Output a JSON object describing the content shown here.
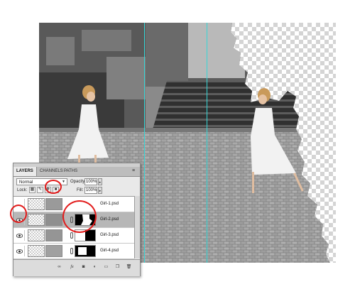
{
  "layers_panel": {
    "tabs": [
      "LAYERS",
      "CHANNELS",
      "PATHS"
    ],
    "blend_mode": "Normal",
    "opacity_label": "Opacity:",
    "opacity_value": "100%",
    "lock_label": "Lock:",
    "fill_label": "Fill:",
    "fill_value": "100%",
    "layers": [
      {
        "name": "Girl-1.psd",
        "visible": false,
        "selected": false,
        "has_mask": false
      },
      {
        "name": "Girl-2.psd",
        "visible": true,
        "selected": true,
        "has_mask": true
      },
      {
        "name": "Girl-3.psd",
        "visible": true,
        "selected": false,
        "has_mask": true
      },
      {
        "name": "Girl-4.psd",
        "visible": true,
        "selected": false,
        "has_mask": true
      }
    ],
    "footer_icons": [
      "link-icon",
      "fx-icon",
      "add-mask-icon",
      "adjustment-icon",
      "group-icon",
      "new-layer-icon",
      "trash-icon"
    ]
  },
  "annotations": {
    "highlight_color": "#e21b1b",
    "highlighted": [
      "lock-all-button",
      "visibility-toggle-girl-2",
      "layer-mask-girl-2"
    ]
  },
  "guides_color": "#35d6d6"
}
